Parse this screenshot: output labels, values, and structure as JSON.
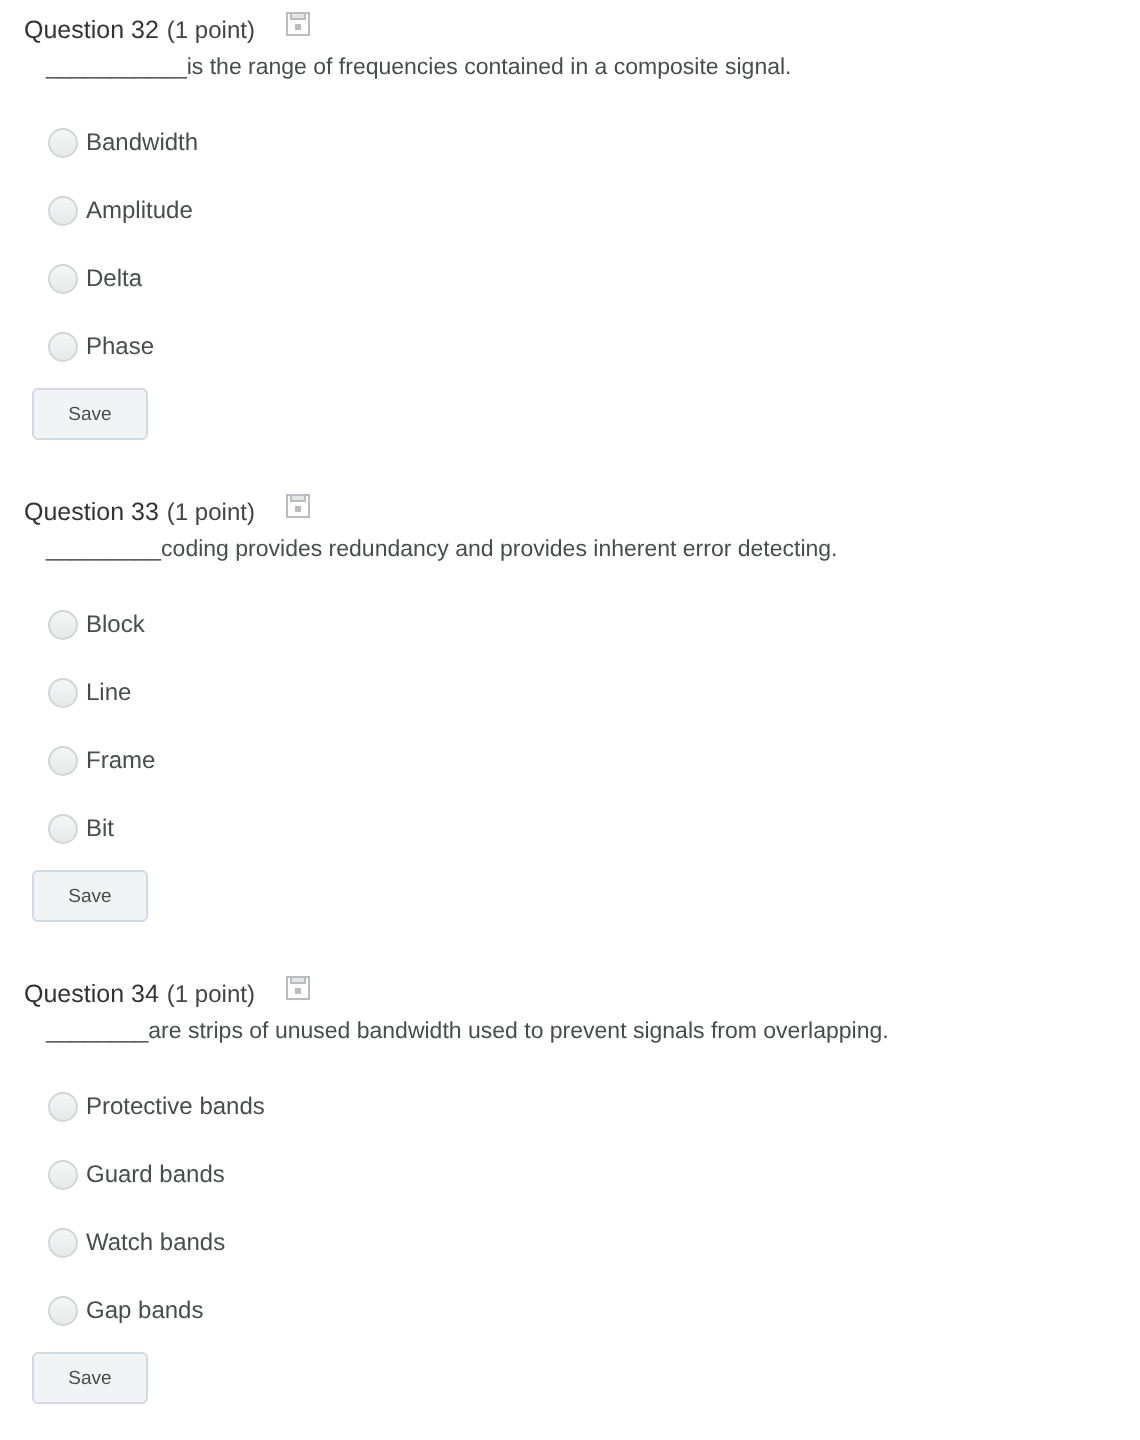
{
  "questions": [
    {
      "title": "Question 32",
      "points": "(1 point)",
      "text": "___________is the range of frequencies contained in a composite signal.",
      "options": [
        {
          "label": "Bandwidth",
          "selected": false
        },
        {
          "label": "Amplitude",
          "selected": false
        },
        {
          "label": "Delta",
          "selected": false
        },
        {
          "label": "Phase",
          "selected": false
        }
      ],
      "button": "Save"
    },
    {
      "title": "Question 33",
      "points": "(1 point)",
      "text": "_________coding provides redundancy and provides inherent error detecting.",
      "options": [
        {
          "label": "Block",
          "selected": false
        },
        {
          "label": "Line",
          "selected": false
        },
        {
          "label": "Frame",
          "selected": false
        },
        {
          "label": "Bit",
          "selected": false
        }
      ],
      "button": "Save"
    },
    {
      "title": "Question 34",
      "points": "(1 point)",
      "text": "________are strips of unused bandwidth used to prevent signals from overlapping.",
      "options": [
        {
          "label": "Protective bands",
          "selected": false
        },
        {
          "label": "Guard bands",
          "selected": false
        },
        {
          "label": "Watch bands",
          "selected": false
        },
        {
          "label": "Gap bands",
          "selected": false
        }
      ],
      "button": "Save"
    }
  ]
}
